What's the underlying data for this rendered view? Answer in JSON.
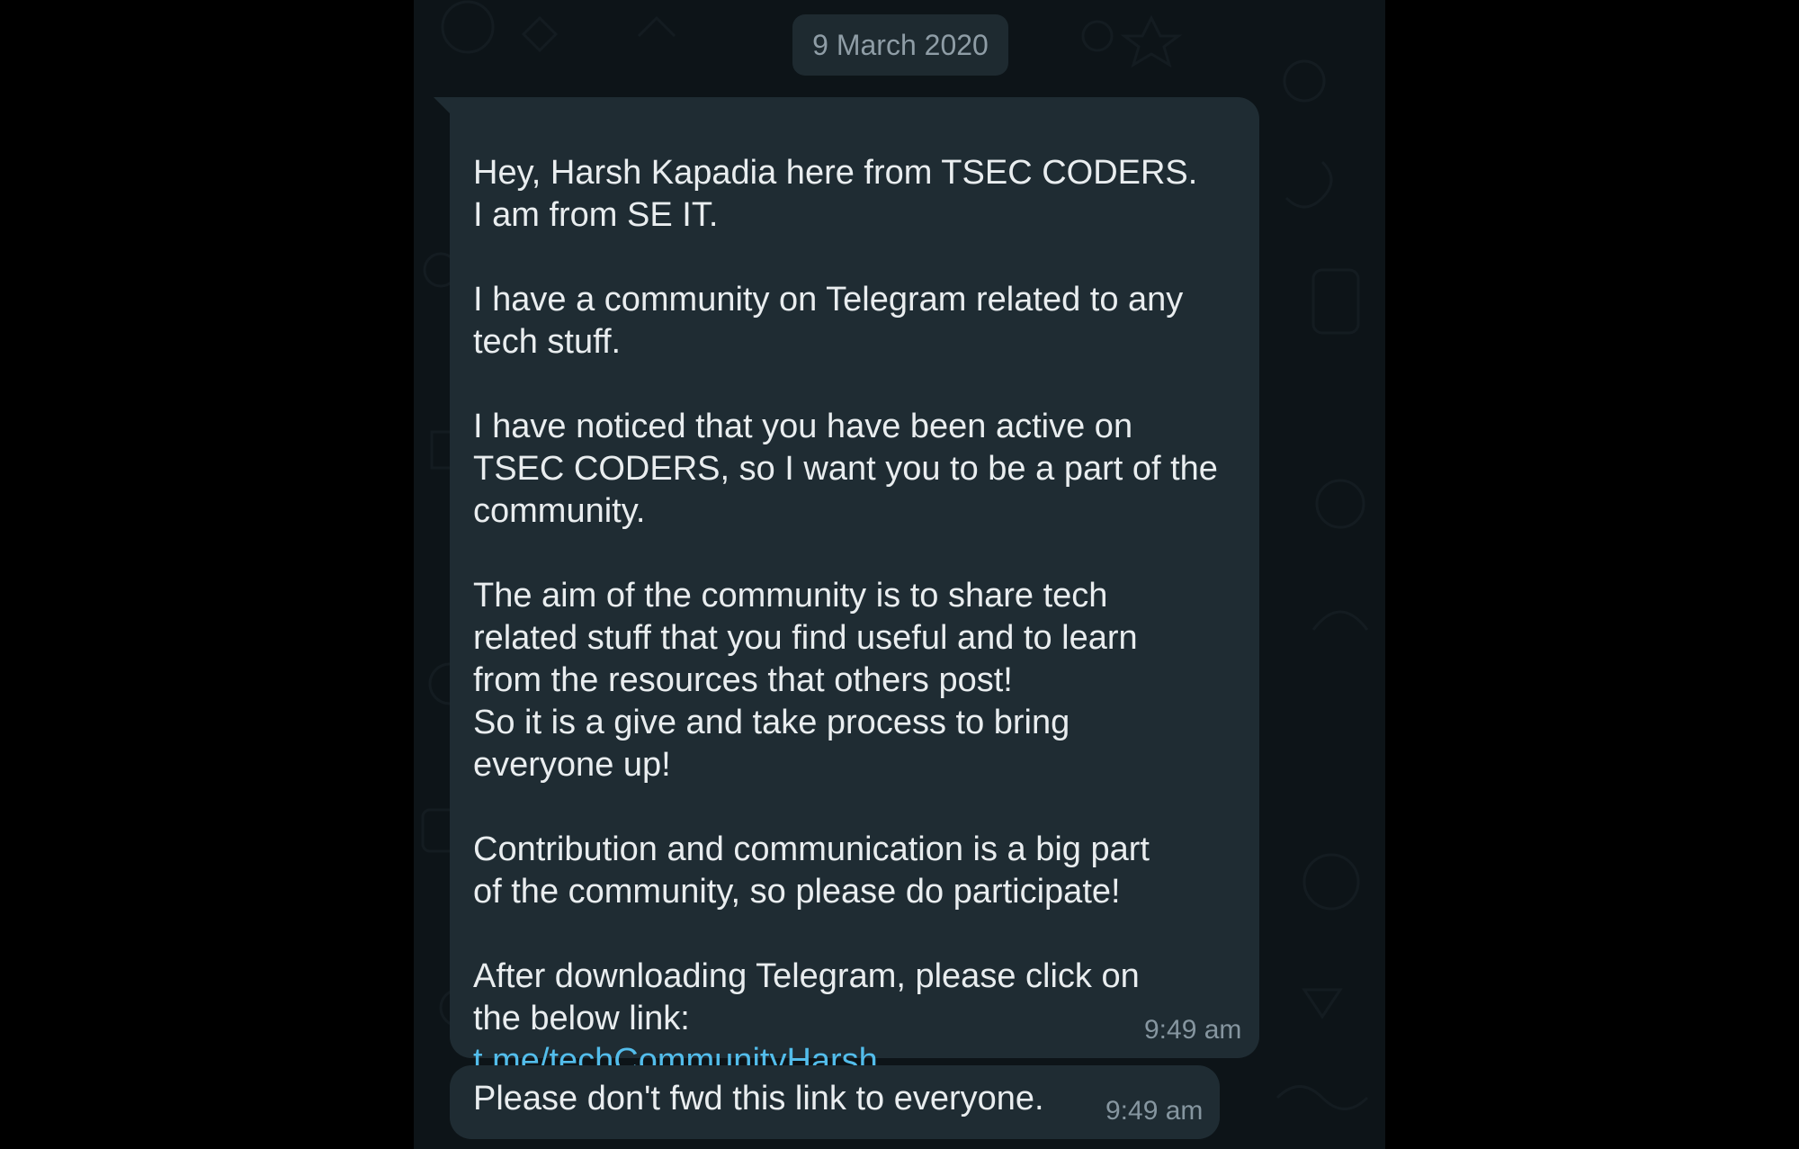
{
  "date_separator": "9 March 2020",
  "messages": [
    {
      "paragraphs": [
        "Hey, Harsh Kapadia here from TSEC CODERS.\nI am from SE IT.",
        "I have a community on Telegram related to any\ntech stuff.",
        "I have noticed that you have been active on\nTSEC CODERS, so I want you to be a part of the\ncommunity.",
        "The aim of the community is to share tech\nrelated stuff that you find useful and to learn\nfrom the resources that others post!\nSo it is a give and take process to bring\neveryone up!",
        "Contribution and communication is a big part\nof the community, so please do participate!",
        "After downloading Telegram, please click on\nthe below link:"
      ],
      "link": "t.me/techCommunityHarsh",
      "time": "9:49 am"
    },
    {
      "text": "Please don't fwd this link to everyone.",
      "time": "9:49 am"
    }
  ],
  "colors": {
    "background": "#0d1418",
    "bubble": "#1f2c33",
    "text": "#e9edef",
    "link": "#53bdeb",
    "timestamp": "#8696a0"
  }
}
